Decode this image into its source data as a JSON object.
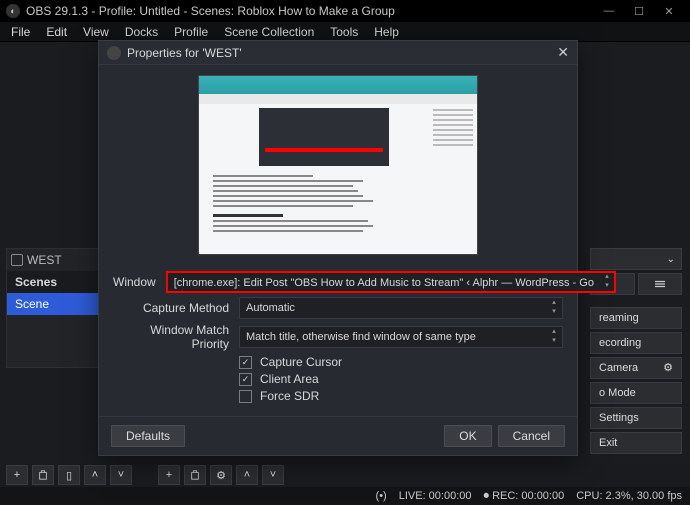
{
  "titlebar": {
    "text": "OBS 29.1.3 - Profile: Untitled - Scenes: Roblox How to Make a Group"
  },
  "menubar": [
    "File",
    "Edit",
    "View",
    "Docks",
    "Profile",
    "Scene Collection",
    "Tools",
    "Help"
  ],
  "scenes": {
    "list_item": "WEST",
    "title": "Scenes",
    "selected": "Scene"
  },
  "right": {
    "btn_streaming": "reaming",
    "btn_recording": "ecording",
    "btn_camera": "Camera",
    "btn_mode": "o Mode",
    "btn_settings": "Settings",
    "btn_exit": "Exit"
  },
  "statusbar": {
    "live": "LIVE: 00:00:00",
    "rec": "REC: 00:00:00",
    "cpu": "CPU: 2.3%, 30.00 fps"
  },
  "modal": {
    "title": "Properties for 'WEST'",
    "labels": {
      "window": "Window",
      "capture_method": "Capture Method",
      "match_priority": "Window Match Priority"
    },
    "values": {
      "window": "[chrome.exe]: Edit Post \"OBS How to Add Music to Stream\" ‹ Alphr — WordPress - Go",
      "capture_method": "Automatic",
      "match_priority": "Match title, otherwise find window of same type"
    },
    "checks": {
      "capture_cursor": {
        "label": "Capture Cursor",
        "checked": true
      },
      "client_area": {
        "label": "Client Area",
        "checked": true
      },
      "force_sdr": {
        "label": "Force SDR",
        "checked": false
      }
    },
    "buttons": {
      "defaults": "Defaults",
      "ok": "OK",
      "cancel": "Cancel"
    }
  }
}
